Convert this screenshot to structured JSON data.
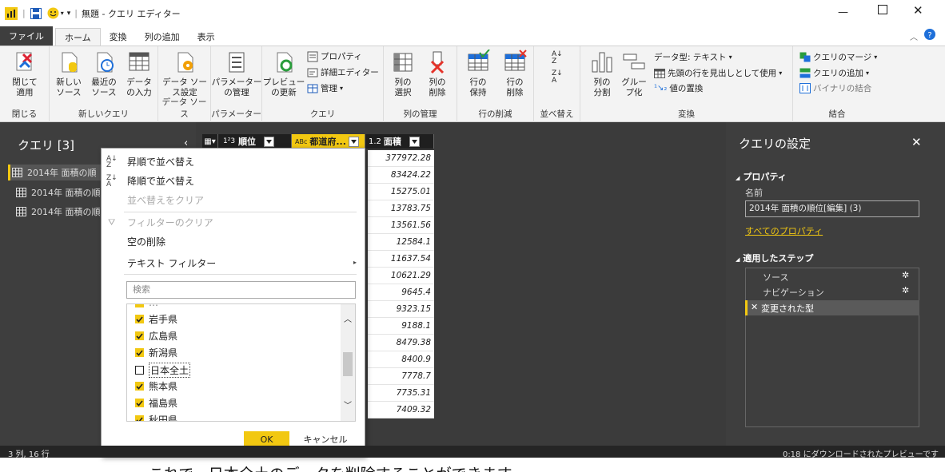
{
  "window": {
    "title": "無題 - クエリ エディター"
  },
  "tabs": [
    "ファイル",
    "ホーム",
    "変換",
    "列の追加",
    "表示"
  ],
  "ribbon": {
    "close_apply": "閉じて\n適用",
    "close_group": "閉じる",
    "new_source": "新しい\nソース",
    "recent_sources": "最近の\nソース",
    "enter_data": "データ\nの入力",
    "new_query_group": "新しいクエリ",
    "data_source_settings": "データ ソー\nス設定",
    "data_source_group": "データ ソース",
    "manage_params": "パラメーター\nの管理",
    "params_group": "パラメーター",
    "refresh_preview": "プレビュー\nの更新",
    "properties": "プロパティ",
    "advanced_editor": "詳細エディター",
    "manage": "管理",
    "query_group": "クエリ",
    "choose_columns": "列の\n選択",
    "remove_columns": "列の\n削除",
    "columns_group": "列の管理",
    "keep_rows": "行の\n保持",
    "remove_rows": "行の\n削除",
    "rows_group": "行の削減",
    "sort_group": "並べ替え",
    "split_column": "列の\n分割",
    "group_by": "グルー\nプ化",
    "data_type": "データ型: テキスト",
    "first_row_header": "先頭の行を見出しとして使用",
    "replace_values": "値の置換",
    "transform_group": "変換",
    "merge_queries": "クエリのマージ",
    "append_queries": "クエリの追加",
    "combine_binaries": "バイナリの結合",
    "combine_group": "結合"
  },
  "queries": {
    "header": "クエリ [3]",
    "items": [
      "2014年 面積の順",
      "2014年 面積の順",
      "2014年 面積の順"
    ]
  },
  "grid": {
    "columns": [
      "順位",
      "都道府...",
      "面積"
    ],
    "col_types": [
      "1²3",
      "ABc",
      "1.2"
    ],
    "values": [
      "377972.28",
      "83424.22",
      "15275.01",
      "13783.75",
      "13561.56",
      "12584.1",
      "11637.54",
      "10621.29",
      "9645.4",
      "9323.15",
      "9188.1",
      "8479.38",
      "8400.9",
      "7778.7",
      "7735.31",
      "7409.32"
    ]
  },
  "menu": {
    "sort_asc": "昇順で並べ替え",
    "sort_desc": "降順で並べ替え",
    "clear_sort": "並べ替えをクリア",
    "clear_filter": "フィルターのクリア",
    "remove_empty": "空の削除",
    "text_filter": "テキスト フィルター",
    "search_placeholder": "検索",
    "items": [
      {
        "label": "岩手県",
        "checked": true
      },
      {
        "label": "広島県",
        "checked": true
      },
      {
        "label": "新潟県",
        "checked": true
      },
      {
        "label": "日本全土",
        "checked": false
      },
      {
        "label": "熊本県",
        "checked": true
      },
      {
        "label": "福島県",
        "checked": true
      },
      {
        "label": "秋田県",
        "checked": true
      }
    ],
    "ok": "OK",
    "cancel": "キャンセル"
  },
  "settings": {
    "title": "クエリの設定",
    "properties": "プロパティ",
    "name_label": "名前",
    "name_value": "2014年 面積の順位[編集] (3)",
    "all_properties": "すべてのプロパティ",
    "applied_steps": "適用したステップ",
    "steps": [
      "ソース",
      "ナビゲーション",
      "変更された型"
    ]
  },
  "status": {
    "left": "3 列, 16 行",
    "right": "0:18 にダウンロードされたプレビューです"
  },
  "caption": "これで、日本全土のデータを削除することができます。",
  "colors": {
    "accent": "#f2c811",
    "dark": "#3e3e3e"
  }
}
